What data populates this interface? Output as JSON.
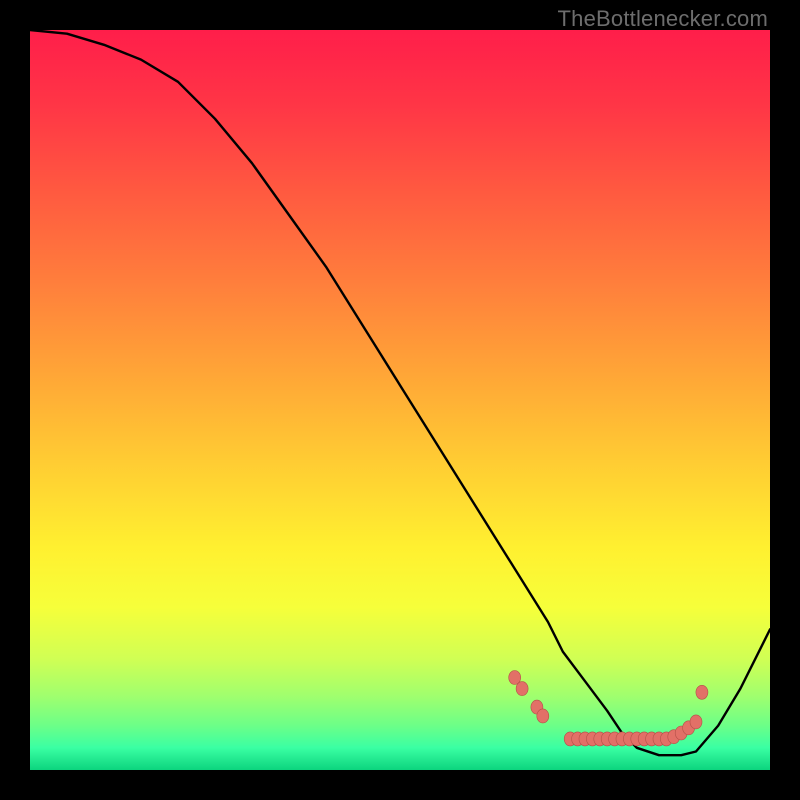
{
  "watermark": "TheBottlenecker.com",
  "gradient": {
    "stops": [
      {
        "offset": 0.0,
        "color": "#ff1e4a"
      },
      {
        "offset": 0.1,
        "color": "#ff3546"
      },
      {
        "offset": 0.22,
        "color": "#ff5a40"
      },
      {
        "offset": 0.34,
        "color": "#ff7e3c"
      },
      {
        "offset": 0.46,
        "color": "#ffa437"
      },
      {
        "offset": 0.58,
        "color": "#ffcb33"
      },
      {
        "offset": 0.7,
        "color": "#fff030"
      },
      {
        "offset": 0.78,
        "color": "#f6ff3a"
      },
      {
        "offset": 0.85,
        "color": "#d0ff54"
      },
      {
        "offset": 0.9,
        "color": "#a0ff6e"
      },
      {
        "offset": 0.94,
        "color": "#6cff88"
      },
      {
        "offset": 0.97,
        "color": "#3affa3"
      },
      {
        "offset": 1.0,
        "color": "#0cd47e"
      }
    ]
  },
  "chart_data": {
    "type": "line",
    "title": "",
    "xlabel": "",
    "ylabel": "",
    "x": [
      0,
      5,
      10,
      15,
      20,
      25,
      30,
      35,
      40,
      45,
      50,
      55,
      60,
      65,
      70,
      72,
      75,
      78,
      80,
      82,
      85,
      88,
      90,
      93,
      96,
      100
    ],
    "values": [
      100,
      99.5,
      98,
      96,
      93,
      88,
      82,
      75,
      68,
      60,
      52,
      44,
      36,
      28,
      20,
      16,
      12,
      8,
      5,
      3,
      2,
      2,
      2.5,
      6,
      11,
      19
    ],
    "xlim": [
      0,
      100
    ],
    "ylim": [
      0,
      100
    ],
    "annotations": {
      "dots": [
        {
          "x": 65.5,
          "y": 12.5
        },
        {
          "x": 66.5,
          "y": 11.0
        },
        {
          "x": 68.5,
          "y": 8.5
        },
        {
          "x": 69.3,
          "y": 7.3
        },
        {
          "x": 73.0,
          "y": 4.2
        },
        {
          "x": 74.0,
          "y": 4.2
        },
        {
          "x": 75.0,
          "y": 4.2
        },
        {
          "x": 76.0,
          "y": 4.2
        },
        {
          "x": 77.0,
          "y": 4.2
        },
        {
          "x": 78.0,
          "y": 4.2
        },
        {
          "x": 79.0,
          "y": 4.2
        },
        {
          "x": 80.0,
          "y": 4.2
        },
        {
          "x": 81.0,
          "y": 4.2
        },
        {
          "x": 82.0,
          "y": 4.2
        },
        {
          "x": 83.0,
          "y": 4.2
        },
        {
          "x": 84.0,
          "y": 4.2
        },
        {
          "x": 85.0,
          "y": 4.2
        },
        {
          "x": 86.0,
          "y": 4.2
        },
        {
          "x": 87.0,
          "y": 4.5
        },
        {
          "x": 88.0,
          "y": 5.0
        },
        {
          "x": 89.0,
          "y": 5.7
        },
        {
          "x": 90.0,
          "y": 6.5
        },
        {
          "x": 90.8,
          "y": 10.5
        }
      ],
      "dot_fill": "#e27067",
      "dot_stroke": "#b45048"
    }
  }
}
